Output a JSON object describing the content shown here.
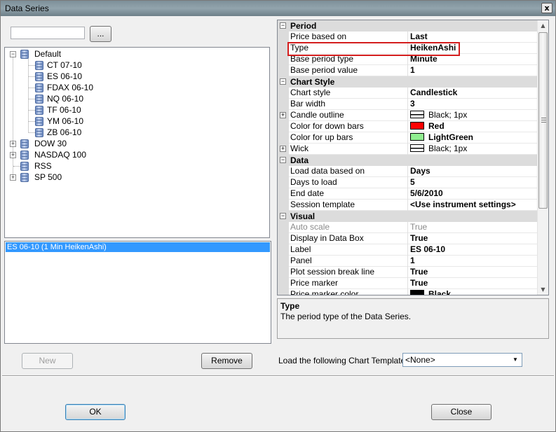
{
  "window": {
    "title": "Data Series",
    "close_label": "x"
  },
  "search": {
    "value": "",
    "browse_label": "..."
  },
  "tree": {
    "groups": [
      {
        "label": "Default",
        "expanded": true,
        "children": [
          "CT 07-10",
          "ES 06-10",
          "FDAX 06-10",
          "NQ 06-10",
          "TF 06-10",
          "YM 06-10",
          "ZB 06-10"
        ]
      },
      {
        "label": "DOW 30",
        "expanded": false
      },
      {
        "label": "NASDAQ 100",
        "expanded": false
      },
      {
        "label": "RSS",
        "expanded": false
      },
      {
        "label": "SP 500",
        "expanded": false
      }
    ]
  },
  "series": {
    "selected": "ES 06-10 (1 Min HeikenAshi)"
  },
  "buttons": {
    "new": "New",
    "remove": "Remove",
    "ok": "OK",
    "close": "Close"
  },
  "properties": {
    "period": {
      "label": "Period",
      "rows": [
        {
          "name": "Price based on",
          "value": "Last"
        },
        {
          "name": "Type",
          "value": "HeikenAshi"
        },
        {
          "name": "Base period type",
          "value": "Minute"
        },
        {
          "name": "Base period value",
          "value": "1"
        }
      ]
    },
    "chart_style": {
      "label": "Chart Style",
      "rows": [
        {
          "name": "Chart style",
          "value": "Candlestick"
        },
        {
          "name": "Bar width",
          "value": "3"
        },
        {
          "name": "Candle outline",
          "value": "Black; 1px"
        },
        {
          "name": "Color for down bars",
          "value": "Red",
          "color": "#ff0000"
        },
        {
          "name": "Color for up bars",
          "value": "LightGreen",
          "color": "#90ee90"
        },
        {
          "name": "Wick",
          "value": "Black; 1px"
        }
      ]
    },
    "data": {
      "label": "Data",
      "rows": [
        {
          "name": "Load data based on",
          "value": "Days"
        },
        {
          "name": "Days to load",
          "value": "5"
        },
        {
          "name": "End date",
          "value": "5/6/2010"
        },
        {
          "name": "Session template",
          "value": "<Use instrument settings>"
        }
      ]
    },
    "visual": {
      "label": "Visual",
      "rows": [
        {
          "name": "Auto scale",
          "value": "True"
        },
        {
          "name": "Display in Data Box",
          "value": "True"
        },
        {
          "name": "Label",
          "value": "ES 06-10"
        },
        {
          "name": "Panel",
          "value": "1"
        },
        {
          "name": "Plot session break line",
          "value": "True"
        },
        {
          "name": "Price marker",
          "value": "True"
        },
        {
          "name": "Price marker color",
          "value": "Black",
          "color": "#000000"
        }
      ]
    }
  },
  "help": {
    "title": "Type",
    "description": "The period type of the Data Series."
  },
  "template": {
    "label": "Load the following Chart Template:",
    "selected": "<None>"
  },
  "colors": {
    "highlight": "#d41e1e",
    "selection": "#3399ff"
  }
}
